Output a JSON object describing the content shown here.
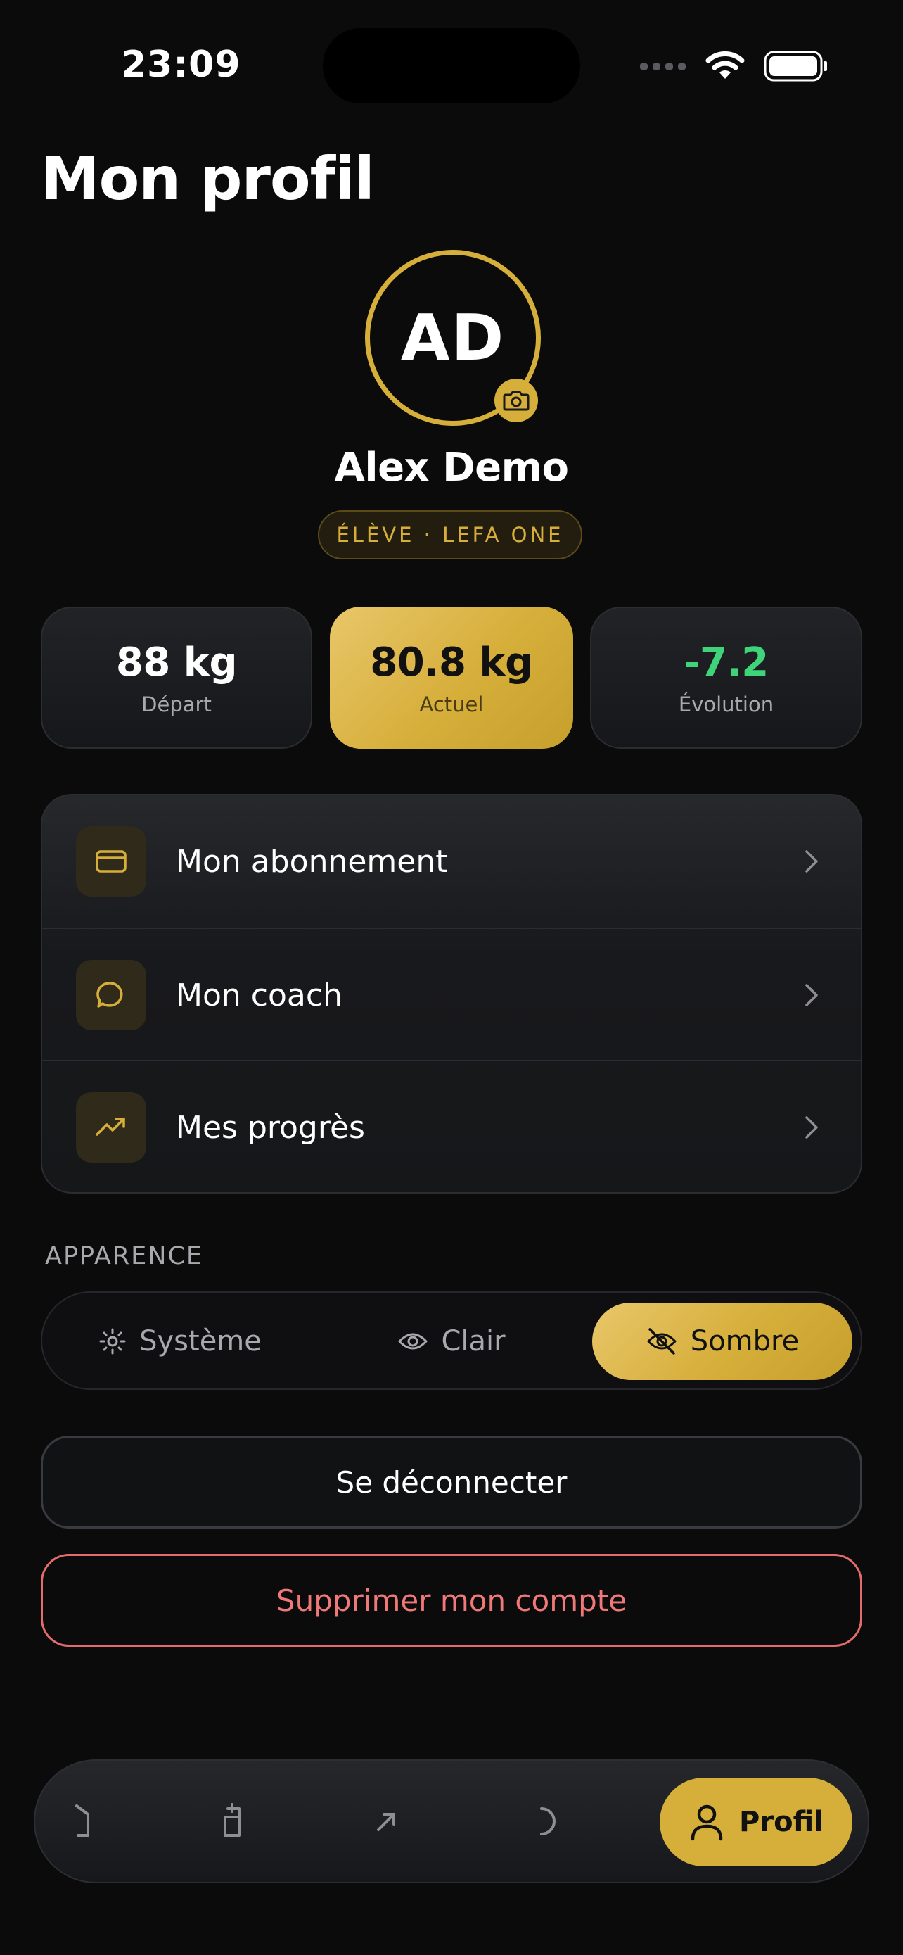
{
  "status_bar": {
    "time": "23:09"
  },
  "header": {
    "title": "Mon profil"
  },
  "profile": {
    "initials": "AD",
    "name": "Alex Demo",
    "role_badge": "ÉLÈVE · LEFA ONE"
  },
  "stats": [
    {
      "value": "88 kg",
      "label": "Départ"
    },
    {
      "value": "80.8 kg",
      "label": "Actuel"
    },
    {
      "value": "-7.2",
      "label": "Évolution"
    }
  ],
  "menu": {
    "items": [
      {
        "label": "Mon abonnement",
        "icon": "credit-card-icon"
      },
      {
        "label": "Mon coach",
        "icon": "chat-bubble-icon"
      },
      {
        "label": "Mes progrès",
        "icon": "trending-up-icon"
      }
    ]
  },
  "appearance": {
    "section_label": "APPARENCE",
    "options": [
      {
        "label": "Système",
        "icon": "sun-icon"
      },
      {
        "label": "Clair",
        "icon": "eye-icon"
      },
      {
        "label": "Sombre",
        "icon": "eye-off-icon"
      }
    ],
    "selected": "Sombre"
  },
  "actions": {
    "logout_label": "Se déconnecter",
    "delete_label": "Supprimer mon compte"
  },
  "tabbar": {
    "tabs": [
      {
        "icon": "home-icon"
      },
      {
        "icon": "clipboard-icon"
      },
      {
        "icon": "arrow-up-right-icon"
      },
      {
        "icon": "loading-icon"
      },
      {
        "icon": "user-icon",
        "label": "Profil"
      }
    ],
    "active": "Profil"
  },
  "colors": {
    "background": "#0b0b0c",
    "accent_gold": "#d6ae3a",
    "positive_green": "#3fd37a",
    "danger_red": "#ef7878"
  }
}
